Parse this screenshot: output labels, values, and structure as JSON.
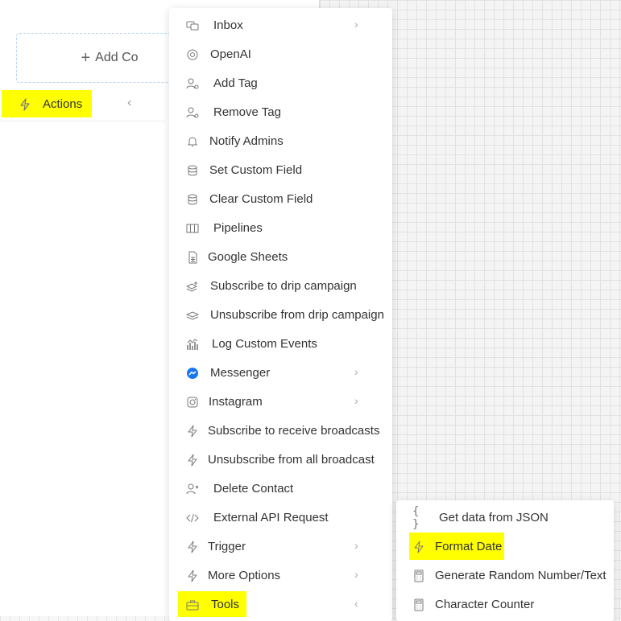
{
  "left_panel": {
    "add_contact_label": "Add Co",
    "actions_label": "Actions"
  },
  "menu": {
    "items": [
      {
        "label": "Inbox",
        "icon": "chat-icon",
        "has_submenu": true
      },
      {
        "label": "OpenAI",
        "icon": "openai-icon",
        "has_submenu": false
      },
      {
        "label": "Add Tag",
        "icon": "user-tag-icon",
        "has_submenu": false
      },
      {
        "label": "Remove Tag",
        "icon": "user-tag-icon",
        "has_submenu": false
      },
      {
        "label": "Notify Admins",
        "icon": "bell-icon",
        "has_submenu": false
      },
      {
        "label": "Set Custom Field",
        "icon": "database-icon",
        "has_submenu": false
      },
      {
        "label": "Clear Custom Field",
        "icon": "database-icon",
        "has_submenu": false
      },
      {
        "label": "Pipelines",
        "icon": "columns-icon",
        "has_submenu": false
      },
      {
        "label": "Google Sheets",
        "icon": "sheet-icon",
        "has_submenu": false
      },
      {
        "label": "Subscribe to drip campaign",
        "icon": "layers-plus-icon",
        "has_submenu": false
      },
      {
        "label": "Unsubscribe from drip campaign",
        "icon": "layers-icon",
        "has_submenu": false
      },
      {
        "label": "Log Custom Events",
        "icon": "chart-icon",
        "has_submenu": false
      },
      {
        "label": "Messenger",
        "icon": "messenger-icon",
        "has_submenu": true
      },
      {
        "label": "Instagram",
        "icon": "instagram-icon",
        "has_submenu": true
      },
      {
        "label": "Subscribe to receive broadcasts",
        "icon": "bolt-icon",
        "has_submenu": false
      },
      {
        "label": "Unsubscribe from all broadcast",
        "icon": "bolt-icon",
        "has_submenu": false
      },
      {
        "label": "Delete Contact",
        "icon": "user-x-icon",
        "has_submenu": false
      },
      {
        "label": "External API Request",
        "icon": "code-icon",
        "has_submenu": false
      },
      {
        "label": "Trigger",
        "icon": "bolt-icon",
        "has_submenu": true
      },
      {
        "label": "More Options",
        "icon": "bolt-icon",
        "has_submenu": true
      },
      {
        "label": "Tools",
        "icon": "toolbox-icon",
        "has_submenu": true
      }
    ]
  },
  "submenu": {
    "items": [
      {
        "label": "Get data from JSON",
        "icon": "braces-icon"
      },
      {
        "label": "Format Date",
        "icon": "bolt-icon"
      },
      {
        "label": "Generate Random Number/Text",
        "icon": "calculator-icon"
      },
      {
        "label": "Character Counter",
        "icon": "calculator-icon"
      }
    ]
  },
  "colors": {
    "highlight": "#ffff00",
    "messenger_blue": "#1877f2"
  }
}
